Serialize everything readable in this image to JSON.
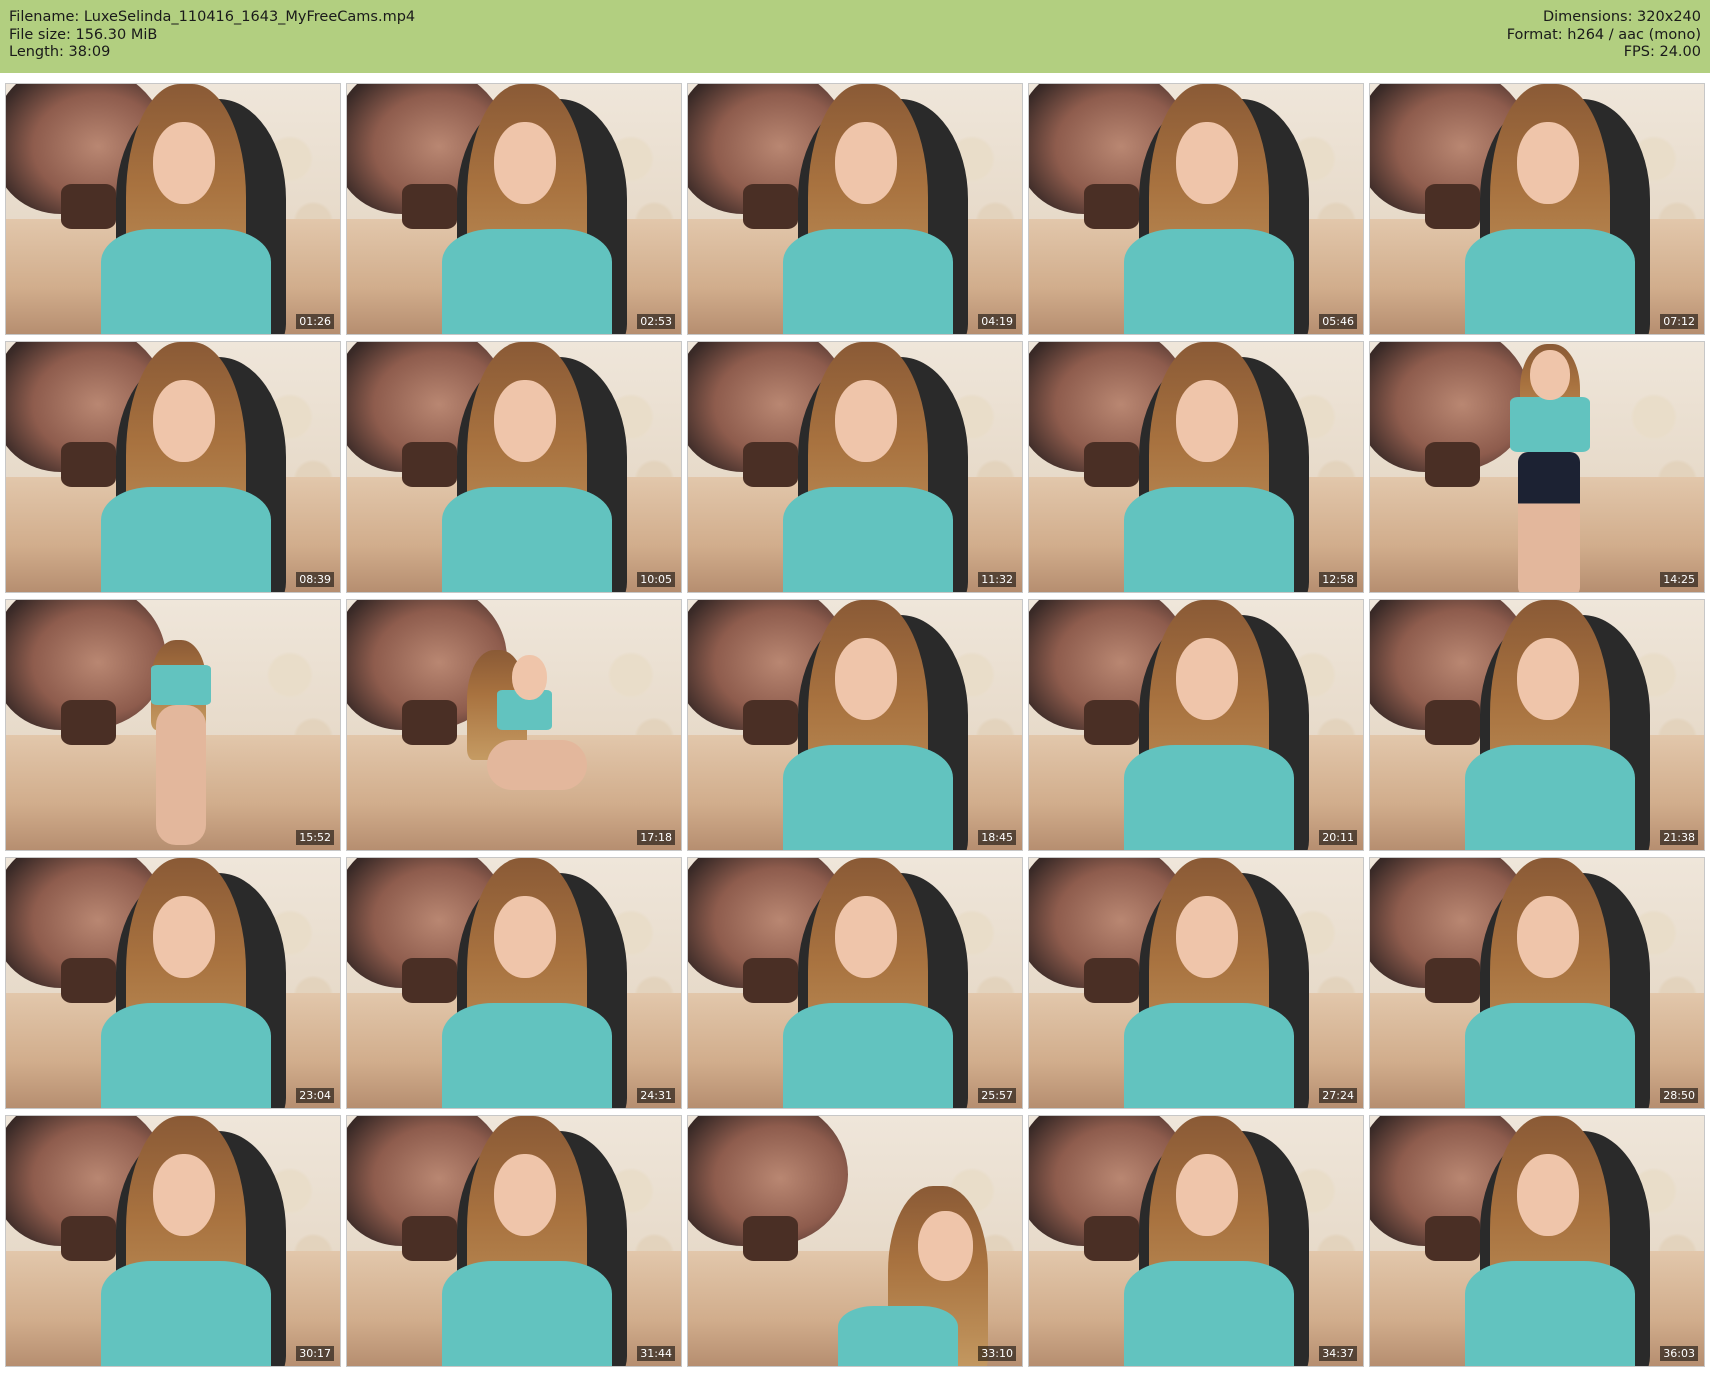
{
  "header": {
    "filename_line": "Filename: LuxeSelinda_110416_1643_MyFreeCams.mp4",
    "filesize_line": "File size: 156.30 MiB",
    "length_line": "Length: 38:09",
    "dimensions_line": "Dimensions: 320x240",
    "format_line": "Format: h264 / aac (mono)",
    "fps_line": "FPS: 24.00"
  },
  "thumbnails": [
    {
      "timestamp": "01:26",
      "pose": "seated"
    },
    {
      "timestamp": "02:53",
      "pose": "seated"
    },
    {
      "timestamp": "04:19",
      "pose": "seated"
    },
    {
      "timestamp": "05:46",
      "pose": "seated"
    },
    {
      "timestamp": "07:12",
      "pose": "seated"
    },
    {
      "timestamp": "08:39",
      "pose": "seated"
    },
    {
      "timestamp": "10:05",
      "pose": "seated"
    },
    {
      "timestamp": "11:32",
      "pose": "seated"
    },
    {
      "timestamp": "12:58",
      "pose": "seated"
    },
    {
      "timestamp": "14:25",
      "pose": "standing"
    },
    {
      "timestamp": "15:52",
      "pose": "back"
    },
    {
      "timestamp": "17:18",
      "pose": "kneeling"
    },
    {
      "timestamp": "18:45",
      "pose": "seated"
    },
    {
      "timestamp": "20:11",
      "pose": "seated"
    },
    {
      "timestamp": "21:38",
      "pose": "seated"
    },
    {
      "timestamp": "23:04",
      "pose": "seated"
    },
    {
      "timestamp": "24:31",
      "pose": "seated"
    },
    {
      "timestamp": "25:57",
      "pose": "seated"
    },
    {
      "timestamp": "27:24",
      "pose": "seated"
    },
    {
      "timestamp": "28:50",
      "pose": "seated"
    },
    {
      "timestamp": "30:17",
      "pose": "seated"
    },
    {
      "timestamp": "31:44",
      "pose": "seated"
    },
    {
      "timestamp": "33:10",
      "pose": "leaning"
    },
    {
      "timestamp": "34:37",
      "pose": "seated"
    },
    {
      "timestamp": "36:03",
      "pose": "seated"
    }
  ],
  "colors": {
    "header_background": "#b2cf80",
    "header_text": "#1a1a1a",
    "page_background": "#ffffff",
    "timestamp_text": "#ffffff"
  }
}
